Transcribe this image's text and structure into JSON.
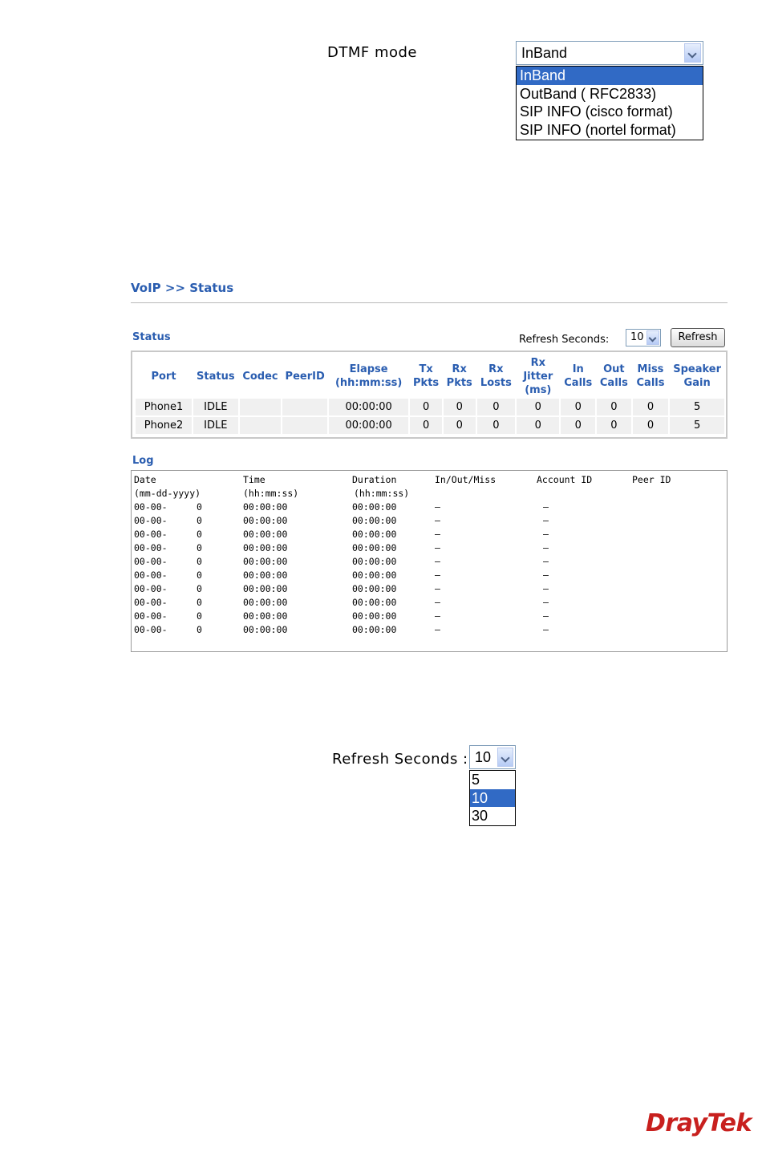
{
  "dtmf": {
    "label": "DTMF mode",
    "selected": "InBand",
    "options": [
      "InBand",
      "OutBand ( RFC2833)",
      "SIP INFO (cisco format)",
      "SIP INFO (nortel format)"
    ]
  },
  "voip_status": {
    "title": "VoIP >> Status",
    "status_heading": "Status",
    "refresh_label": "Refresh Seconds:",
    "refresh_value": "10",
    "refresh_button": "Refresh",
    "columns": [
      [
        "Port"
      ],
      [
        "Status"
      ],
      [
        "Codec"
      ],
      [
        "PeerID"
      ],
      [
        "Elapse",
        "(hh:mm:ss)"
      ],
      [
        "Tx",
        "Pkts"
      ],
      [
        "Rx",
        "Pkts"
      ],
      [
        "Rx",
        "Losts"
      ],
      [
        "Rx",
        "Jitter",
        "(ms)"
      ],
      [
        "In",
        "Calls"
      ],
      [
        "Out",
        "Calls"
      ],
      [
        "Miss",
        "Calls"
      ],
      [
        "Speaker",
        "Gain"
      ]
    ],
    "rows": [
      [
        "Phone1",
        "IDLE",
        "",
        "",
        "00:00:00",
        "0",
        "0",
        "0",
        "0",
        "0",
        "0",
        "0",
        "5"
      ],
      [
        "Phone2",
        "IDLE",
        "",
        "",
        "00:00:00",
        "0",
        "0",
        "0",
        "0",
        "0",
        "0",
        "0",
        "5"
      ]
    ],
    "log_heading": "Log",
    "log_header": [
      "Date",
      "Time",
      "Duration",
      "In/Out/Miss",
      "Account ID",
      "Peer ID"
    ],
    "log_subheader": [
      "(mm-dd-yyyy)",
      "(hh:mm:ss)",
      "(hh:mm:ss)"
    ],
    "log_rows": [
      [
        "00-00-",
        "0",
        "00:00:00",
        "00:00:00",
        "–",
        "–"
      ],
      [
        "00-00-",
        "0",
        "00:00:00",
        "00:00:00",
        "–",
        "–"
      ],
      [
        "00-00-",
        "0",
        "00:00:00",
        "00:00:00",
        "–",
        "–"
      ],
      [
        "00-00-",
        "0",
        "00:00:00",
        "00:00:00",
        "–",
        "–"
      ],
      [
        "00-00-",
        "0",
        "00:00:00",
        "00:00:00",
        "–",
        "–"
      ],
      [
        "00-00-",
        "0",
        "00:00:00",
        "00:00:00",
        "–",
        "–"
      ],
      [
        "00-00-",
        "0",
        "00:00:00",
        "00:00:00",
        "–",
        "–"
      ],
      [
        "00-00-",
        "0",
        "00:00:00",
        "00:00:00",
        "–",
        "–"
      ],
      [
        "00-00-",
        "0",
        "00:00:00",
        "00:00:00",
        "–",
        "–"
      ],
      [
        "00-00-",
        "0",
        "00:00:00",
        "00:00:00",
        "–",
        "–"
      ]
    ]
  },
  "refresh_dropdown": {
    "label": "Refresh Seconds :",
    "selected": "10",
    "options": [
      "5",
      "10",
      "30"
    ]
  },
  "brand": {
    "logo_text": "DrayTek"
  },
  "colors": {
    "heading_blue": "#2a5db0",
    "selection_blue": "#316ac5",
    "brand_red": "#c8201e"
  }
}
